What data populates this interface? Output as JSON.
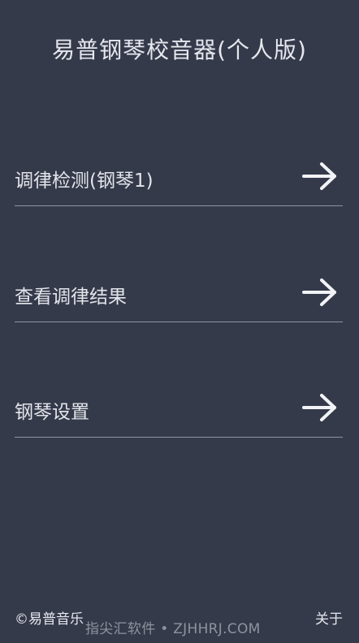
{
  "header": {
    "title": "易普钢琴校音器(个人版)"
  },
  "menu": {
    "items": [
      {
        "label": "调律检测(钢琴1)",
        "icon": "arrow-right-icon"
      },
      {
        "label": "查看调律结果",
        "icon": "arrow-right-icon"
      },
      {
        "label": "钢琴设置",
        "icon": "arrow-right-icon"
      }
    ]
  },
  "footer": {
    "copyright": "©易普音乐",
    "about": "关于",
    "watermark": "指尖汇软件 • ZJHHRJ.COM"
  },
  "colors": {
    "background": "#353a4b",
    "text": "#e3e5ea",
    "divider": "#8d93a3"
  }
}
